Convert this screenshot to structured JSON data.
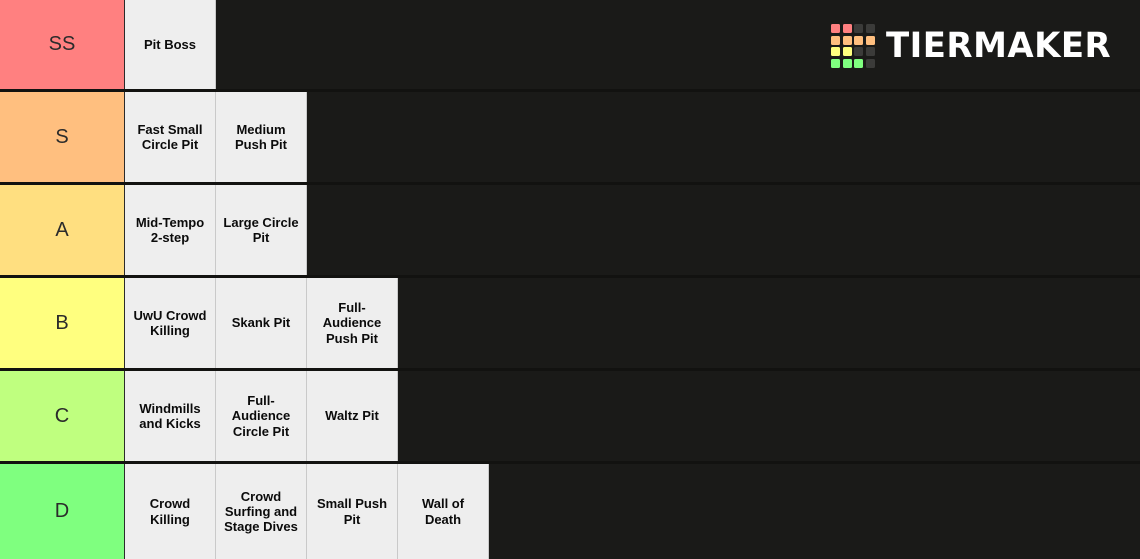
{
  "brand": {
    "name": "TIERMAKER",
    "logo_icon": "tiermaker-grid-icon",
    "grid_colors": [
      [
        "#ff8080",
        "#ff8080",
        "#3b3b39",
        "#3b3b39"
      ],
      [
        "#ffbf7f",
        "#ffbf7f",
        "#ffbf7f",
        "#ffbf7f"
      ],
      [
        "#ffff7f",
        "#ffff7f",
        "#3b3b39",
        "#3b3b39"
      ],
      [
        "#7fff7f",
        "#7fff7f",
        "#7fff7f",
        "#3b3b39"
      ]
    ]
  },
  "background_color": "#1a1a18",
  "item_background_color": "#eeeeee",
  "tiers": [
    {
      "label": "SS",
      "color": "#ff8080",
      "items": [
        {
          "label": "Pit Boss"
        }
      ]
    },
    {
      "label": "S",
      "color": "#ffbf7f",
      "items": [
        {
          "label": "Fast Small Circle Pit"
        },
        {
          "label": "Medium Push Pit"
        }
      ]
    },
    {
      "label": "A",
      "color": "#ffdf80",
      "items": [
        {
          "label": "Mid-Tempo 2-step"
        },
        {
          "label": "Large Circle Pit"
        }
      ]
    },
    {
      "label": "B",
      "color": "#ffff7f",
      "items": [
        {
          "label": "UwU Crowd Killing"
        },
        {
          "label": "Skank Pit"
        },
        {
          "label": "Full-Audience Push Pit"
        }
      ]
    },
    {
      "label": "C",
      "color": "#bfff7f",
      "items": [
        {
          "label": "Windmills and Kicks"
        },
        {
          "label": "Full-Audience Circle Pit"
        },
        {
          "label": "Waltz Pit"
        }
      ]
    },
    {
      "label": "D",
      "color": "#7fff7f",
      "items": [
        {
          "label": "Crowd Killing"
        },
        {
          "label": "Crowd Surfing and Stage Dives"
        },
        {
          "label": "Small Push Pit"
        },
        {
          "label": "Wall of Death"
        }
      ]
    }
  ]
}
